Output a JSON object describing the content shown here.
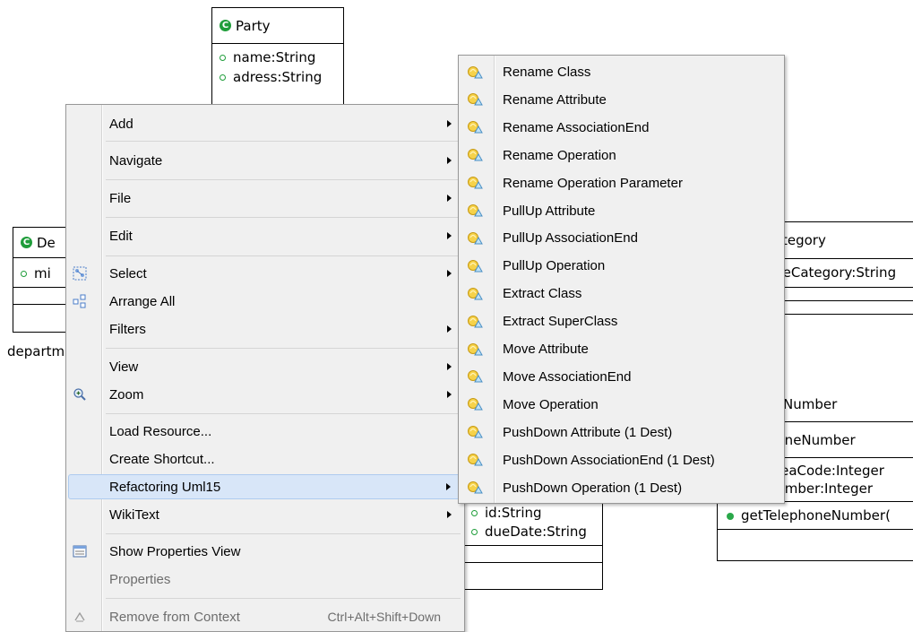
{
  "diagram": {
    "party": {
      "name": "Party",
      "attributes": [
        "name:String",
        "adress:String"
      ]
    },
    "department": {
      "name": "De",
      "attributes": [
        "mi"
      ],
      "label": "departm"
    },
    "category": {
      "name": "tegory",
      "attributes": [
        "meCategory:String"
      ]
    },
    "telephone": {
      "outer_label": "Number",
      "name": "honeNumber",
      "attributes": [
        "AreaCode:Integer",
        "Number:Integer"
      ],
      "operations": [
        "getTelephoneNumber("
      ]
    },
    "task": {
      "attributes": [
        "id:String",
        "dueDate:String"
      ]
    }
  },
  "context_menu": {
    "items": [
      {
        "label": "Add"
      },
      {
        "label": "Navigate"
      },
      {
        "label": "File"
      },
      {
        "label": "Edit"
      },
      {
        "label": "Select",
        "icon": "select-icon"
      },
      {
        "label": "Arrange All",
        "icon": "arrange-all-icon"
      },
      {
        "label": "Filters"
      },
      {
        "label": "View"
      },
      {
        "label": "Zoom",
        "icon": "zoom-icon"
      },
      {
        "label": "Load Resource..."
      },
      {
        "label": "Create Shortcut..."
      },
      {
        "label": "Refactoring Uml15",
        "highlighted": true
      },
      {
        "label": "WikiText"
      },
      {
        "label": "Show Properties View",
        "icon": "properties-view-icon"
      },
      {
        "label": "Properties",
        "disabled": true
      },
      {
        "label": "Remove from Context",
        "shortcut": "Ctrl+Alt+Shift+Down",
        "disabled": true,
        "icon": "remove-context-icon"
      }
    ]
  },
  "refactoring_submenu": {
    "items": [
      "Rename Class",
      "Rename Attribute",
      "Rename AssociationEnd",
      "Rename Operation",
      "Rename Operation Parameter",
      "PullUp Attribute",
      "PullUp AssociationEnd",
      "PullUp Operation",
      "Extract Class",
      "Extract SuperClass",
      "Move Attribute",
      "Move AssociationEnd",
      "Move Operation",
      "PushDown Attribute (1 Dest)",
      "PushDown AssociationEnd (1 Dest)",
      "PushDown Operation (1 Dest)"
    ],
    "icon": "refactoring-icon"
  },
  "colors": {
    "class_icon": "#1f9d3a",
    "menu_bg": "#f0f0f0",
    "highlight": "#d8e6f8"
  }
}
